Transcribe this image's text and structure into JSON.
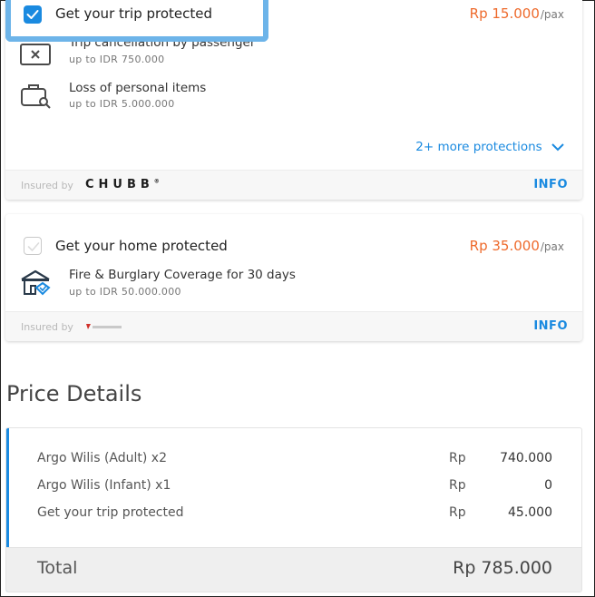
{
  "trip_protection": {
    "title": "Get your trip protected",
    "checked": true,
    "price": "Rp 15.000",
    "price_unit": "/pax",
    "coverages": [
      {
        "title": "Trip cancellation by passenger",
        "limit": "up to IDR 750.000",
        "icon": "cancel-ticket-icon"
      },
      {
        "title": "Loss of personal items",
        "limit": "up to IDR 5.000.000",
        "icon": "luggage-search-icon"
      }
    ],
    "more_label": "2+ more protections",
    "insured_by_label": "Insured by",
    "insurer_logo_text": "CHUBB",
    "info_label": "INFO"
  },
  "home_protection": {
    "title": "Get your home protected",
    "checked": false,
    "price": "Rp 35.000",
    "price_unit": "/pax",
    "coverages": [
      {
        "title": "Fire & Burglary Coverage for 30 days",
        "limit": "up to IDR 50.000.000",
        "icon": "house-shield-icon"
      }
    ],
    "insured_by_label": "Insured by",
    "insurer_logo_text": "sinarmas",
    "info_label": "INFO"
  },
  "price_details": {
    "title": "Price Details",
    "rows": [
      {
        "label": "Argo Wilis (Adult) x2",
        "currency": "Rp",
        "value": "740.000"
      },
      {
        "label": "Argo Wilis (Infant) x1",
        "currency": "Rp",
        "value": "0"
      },
      {
        "label": "Get your trip protected",
        "currency": "Rp",
        "value": "45.000"
      }
    ],
    "total_label": "Total",
    "total_value": "Rp 785.000"
  },
  "colors": {
    "accent_blue": "#1a8ae0",
    "price_orange": "#ee6a2c",
    "highlight_blue": "#6db4e9"
  }
}
